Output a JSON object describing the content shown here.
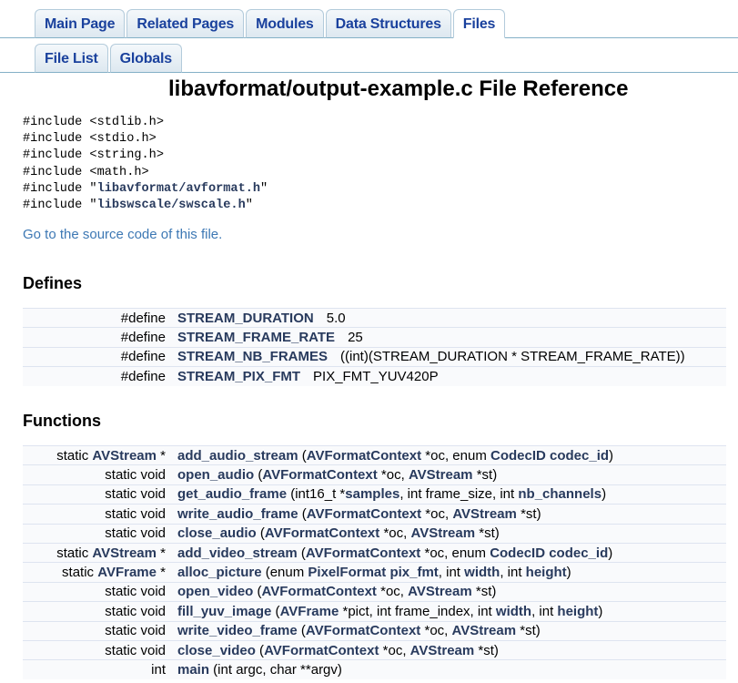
{
  "tabs": [
    "Main Page",
    "Related Pages",
    "Modules",
    "Data Structures",
    "Files"
  ],
  "active_tab": "Files",
  "subtabs": [
    "File List",
    "Globals"
  ],
  "title": "libavformat/output-example.c File Reference",
  "includes": [
    {
      "pre": "#include <stdlib.h>",
      "link": "",
      "post": ""
    },
    {
      "pre": "#include <stdio.h>",
      "link": "",
      "post": ""
    },
    {
      "pre": "#include <string.h>",
      "link": "",
      "post": ""
    },
    {
      "pre": "#include <math.h>",
      "link": "",
      "post": ""
    },
    {
      "pre": "#include \"",
      "link": "libavformat/avformat.h",
      "post": "\""
    },
    {
      "pre": "#include \"",
      "link": "libswscale/swscale.h",
      "post": "\""
    }
  ],
  "source_link": "Go to the source code of this file.",
  "defines_heading": "Defines",
  "defines": [
    {
      "kw": "#define",
      "name": "STREAM_DURATION",
      "value": "5.0"
    },
    {
      "kw": "#define",
      "name": "STREAM_FRAME_RATE",
      "value": "25"
    },
    {
      "kw": "#define",
      "name": "STREAM_NB_FRAMES",
      "value": "((int)(STREAM_DURATION * STREAM_FRAME_RATE))"
    },
    {
      "kw": "#define",
      "name": "STREAM_PIX_FMT",
      "value": "PIX_FMT_YUV420P"
    }
  ],
  "functions_heading": "Functions",
  "functions": [
    {
      "ret": [
        [
          "static ",
          0
        ],
        [
          "AVStream",
          1
        ],
        [
          " *",
          0
        ]
      ],
      "name": "add_audio_stream",
      "args": [
        [
          " (",
          0
        ],
        [
          "AVFormatContext",
          1
        ],
        [
          " *oc, enum ",
          0
        ],
        [
          "CodecID",
          1
        ],
        [
          " ",
          0
        ],
        [
          "codec_id",
          1
        ],
        [
          ")",
          0
        ]
      ]
    },
    {
      "ret": [
        [
          "static void",
          0
        ]
      ],
      "name": "open_audio",
      "args": [
        [
          " (",
          0
        ],
        [
          "AVFormatContext",
          1
        ],
        [
          " *oc, ",
          0
        ],
        [
          "AVStream",
          1
        ],
        [
          " *st)",
          0
        ]
      ]
    },
    {
      "ret": [
        [
          "static void",
          0
        ]
      ],
      "name": "get_audio_frame",
      "args": [
        [
          " (int16_t *",
          0
        ],
        [
          "samples",
          1
        ],
        [
          ", int frame_size, int ",
          0
        ],
        [
          "nb_channels",
          1
        ],
        [
          ")",
          0
        ]
      ]
    },
    {
      "ret": [
        [
          "static void",
          0
        ]
      ],
      "name": "write_audio_frame",
      "args": [
        [
          " (",
          0
        ],
        [
          "AVFormatContext",
          1
        ],
        [
          " *oc, ",
          0
        ],
        [
          "AVStream",
          1
        ],
        [
          " *st)",
          0
        ]
      ]
    },
    {
      "ret": [
        [
          "static void",
          0
        ]
      ],
      "name": "close_audio",
      "args": [
        [
          " (",
          0
        ],
        [
          "AVFormatContext",
          1
        ],
        [
          " *oc, ",
          0
        ],
        [
          "AVStream",
          1
        ],
        [
          " *st)",
          0
        ]
      ]
    },
    {
      "ret": [
        [
          "static ",
          0
        ],
        [
          "AVStream",
          1
        ],
        [
          " *",
          0
        ]
      ],
      "name": "add_video_stream",
      "args": [
        [
          " (",
          0
        ],
        [
          "AVFormatContext",
          1
        ],
        [
          " *oc, enum ",
          0
        ],
        [
          "CodecID",
          1
        ],
        [
          " ",
          0
        ],
        [
          "codec_id",
          1
        ],
        [
          ")",
          0
        ]
      ]
    },
    {
      "ret": [
        [
          "static ",
          0
        ],
        [
          "AVFrame",
          1
        ],
        [
          " *",
          0
        ]
      ],
      "name": "alloc_picture",
      "args": [
        [
          " (enum ",
          0
        ],
        [
          "PixelFormat",
          1
        ],
        [
          " ",
          0
        ],
        [
          "pix_fmt",
          1
        ],
        [
          ", int ",
          0
        ],
        [
          "width",
          1
        ],
        [
          ", int ",
          0
        ],
        [
          "height",
          1
        ],
        [
          ")",
          0
        ]
      ]
    },
    {
      "ret": [
        [
          "static void",
          0
        ]
      ],
      "name": "open_video",
      "args": [
        [
          " (",
          0
        ],
        [
          "AVFormatContext",
          1
        ],
        [
          " *oc, ",
          0
        ],
        [
          "AVStream",
          1
        ],
        [
          " *st)",
          0
        ]
      ]
    },
    {
      "ret": [
        [
          "static void",
          0
        ]
      ],
      "name": "fill_yuv_image",
      "args": [
        [
          " (",
          0
        ],
        [
          "AVFrame",
          1
        ],
        [
          " *pict, int frame_index, int ",
          0
        ],
        [
          "width",
          1
        ],
        [
          ", int ",
          0
        ],
        [
          "height",
          1
        ],
        [
          ")",
          0
        ]
      ]
    },
    {
      "ret": [
        [
          "static void",
          0
        ]
      ],
      "name": "write_video_frame",
      "args": [
        [
          " (",
          0
        ],
        [
          "AVFormatContext",
          1
        ],
        [
          " *oc, ",
          0
        ],
        [
          "AVStream",
          1
        ],
        [
          " *st)",
          0
        ]
      ]
    },
    {
      "ret": [
        [
          "static void",
          0
        ]
      ],
      "name": "close_video",
      "args": [
        [
          " (",
          0
        ],
        [
          "AVFormatContext",
          1
        ],
        [
          " *oc, ",
          0
        ],
        [
          "AVStream",
          1
        ],
        [
          " *st)",
          0
        ]
      ]
    },
    {
      "ret": [
        [
          "int",
          0
        ]
      ],
      "name": "main",
      "args": [
        [
          " (int argc, char **argv)",
          0
        ]
      ]
    }
  ]
}
